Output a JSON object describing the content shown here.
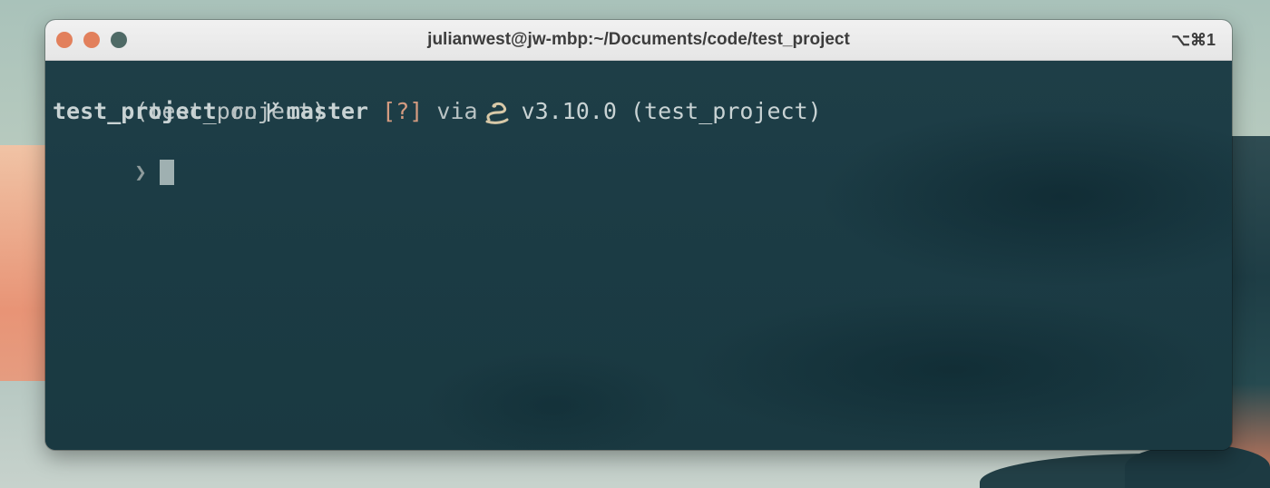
{
  "window": {
    "title": "julianwest@jw-mbp:~/Documents/code/test_project",
    "shortcut": "⌥⌘1"
  },
  "terminal": {
    "line1": {
      "venv": "(test_project)"
    },
    "line2": {
      "directory": "test_project",
      "on_word": "on",
      "branch": "master",
      "git_status": "[?]",
      "via_word": "via",
      "python_version": "v3.10.0",
      "venv": "(test_project)"
    },
    "line3": {
      "prompt_char": "❯"
    }
  },
  "icons": {
    "git_branch": "git-branch-icon",
    "python": "python-snake-icon"
  },
  "colors": {
    "terminal_bg": "#1b3b44",
    "text": "#c9d3d4",
    "git_status": "#d49b80",
    "close_button": "#e2805c",
    "minimize_button": "#e2805c",
    "zoom_button": "#4f6a66"
  }
}
